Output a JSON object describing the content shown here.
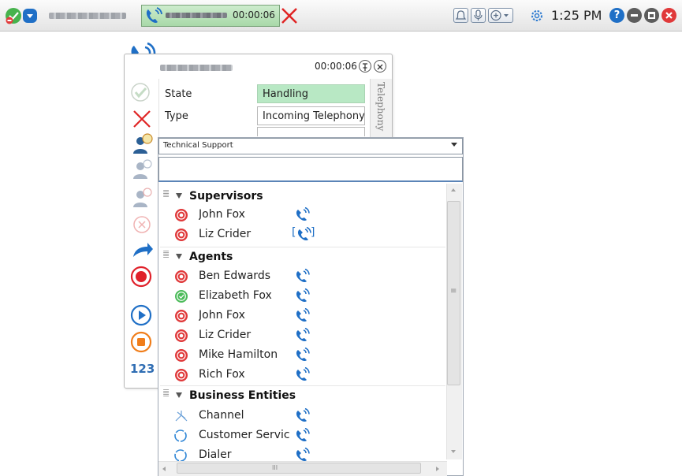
{
  "toolbar": {
    "call_timer": "00:00:06",
    "clock": "1:25 PM",
    "help_glyph": "?"
  },
  "panel": {
    "timer": "00:00:06",
    "tab_label": "Telephony",
    "fields": [
      {
        "label": "State",
        "value": "Handling"
      },
      {
        "label": "Type",
        "value": "Incoming Telephony"
      }
    ],
    "keypad_label": "123"
  },
  "transfer": {
    "queue_selected": "Technical Support",
    "search_value": "",
    "groups": [
      {
        "title": "Supervisors",
        "items": [
          {
            "name": "John Fox",
            "status": "busy"
          },
          {
            "name": "Liz Crider",
            "status": "busy"
          }
        ]
      },
      {
        "title": "Agents",
        "items": [
          {
            "name": "Ben Edwards",
            "status": "busy"
          },
          {
            "name": "Elizabeth Fox",
            "status": "available"
          },
          {
            "name": "John Fox",
            "status": "busy"
          },
          {
            "name": "Liz Crider",
            "status": "busy"
          },
          {
            "name": "Mike Hamilton",
            "status": "busy"
          },
          {
            "name": "Rich Fox",
            "status": "busy"
          }
        ]
      },
      {
        "title": "Business Entities",
        "items": [
          {
            "name": "Channel"
          },
          {
            "name": "Customer Servic"
          },
          {
            "name": "Dialer"
          }
        ]
      }
    ],
    "scroll": {
      "h_thumb_glyph": "III",
      "v_thumb_glyph": "≡"
    }
  },
  "colors": {
    "accent_blue": "#1f6fc6",
    "busy_red": "#e0393a",
    "available_green": "#4cbb5a",
    "handling_green": "#b8e8c4",
    "record_red": "#e0202a",
    "stop_orange": "#f07d1a"
  },
  "icons": [
    "status-icon",
    "dropdown-icon",
    "phone-icon",
    "close-icon",
    "bell-icon",
    "mic-icon",
    "add-icon",
    "gear-icon",
    "help-icon",
    "minimize-icon",
    "maximize-icon",
    "pin-icon",
    "check-icon",
    "consult-icon",
    "transfer-icon",
    "record-icon",
    "play-icon",
    "stop-icon",
    "channel-icon",
    "queue-icon"
  ]
}
